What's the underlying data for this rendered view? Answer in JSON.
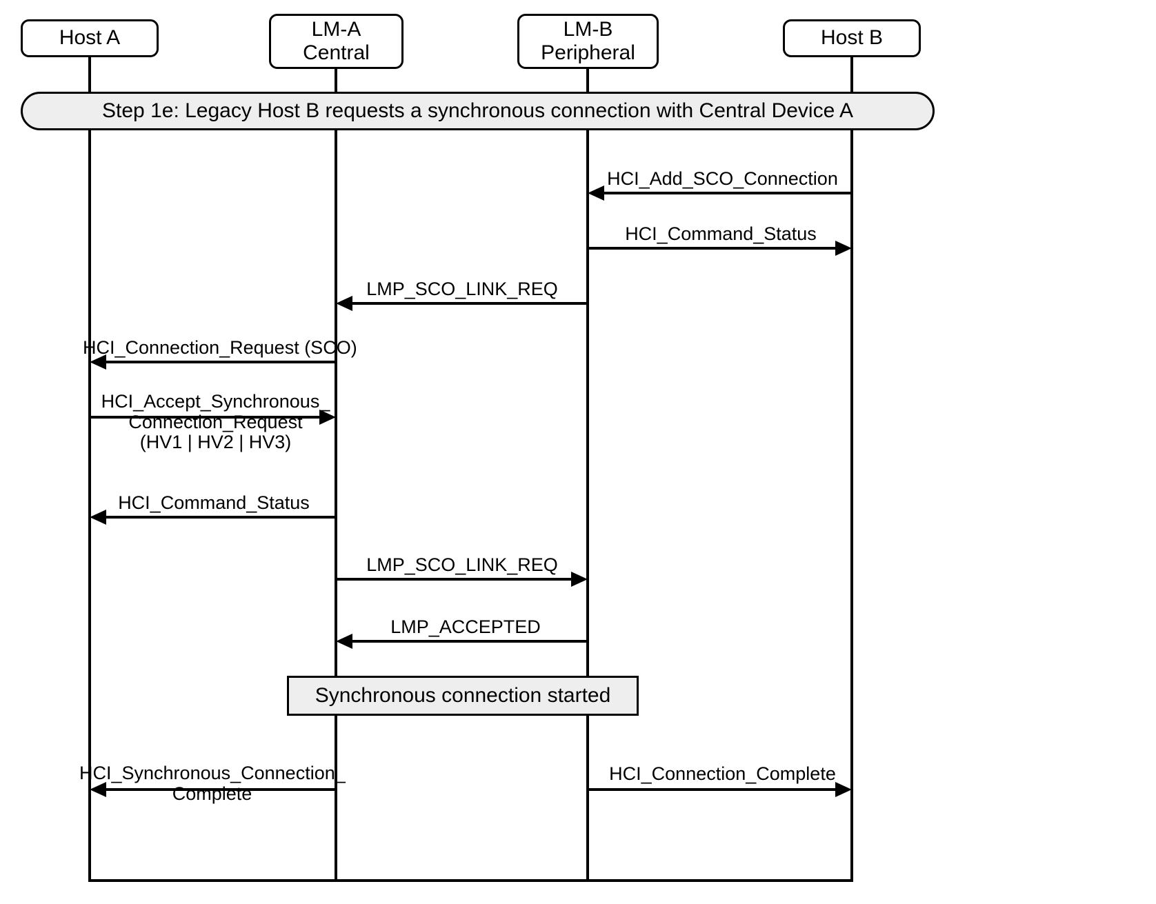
{
  "participants": {
    "hostA": "Host A",
    "lmA": "LM-A\nCentral",
    "lmB": "LM-B\nPeripheral",
    "hostB": "Host B"
  },
  "step_banner": "Step 1e:  Legacy Host B requests a synchronous connection with Central Device A",
  "messages": {
    "m1": "HCI_Add_SCO_Connection",
    "m2": "HCI_Command_Status",
    "m3": "LMP_SCO_LINK_REQ",
    "m4": "HCI_Connection_Request (SCO)",
    "m5": "HCI_Accept_Synchronous_\nConnection_Request\n(HV1 | HV2 | HV3)",
    "m6": "HCI_Command_Status",
    "m7": "LMP_SCO_LINK_REQ",
    "m8": "LMP_ACCEPTED",
    "m9": "HCI_Synchronous_Connection_\nComplete",
    "m10": "HCI_Connection_Complete"
  },
  "note": "Synchronous connection started"
}
